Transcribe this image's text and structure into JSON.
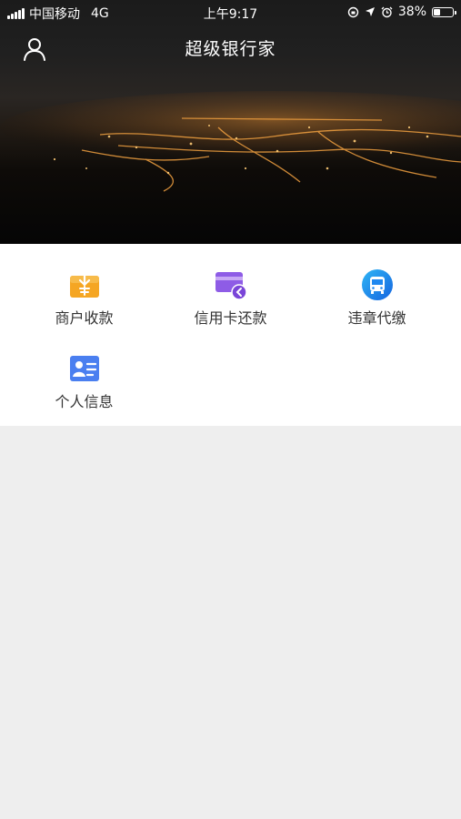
{
  "status_bar": {
    "carrier": "中国移动",
    "network": "4G",
    "time": "上午9:17",
    "battery_percent": "38%",
    "battery_level": 0.38
  },
  "header": {
    "title": "超级银行家",
    "user_icon": "user-icon"
  },
  "menu": {
    "items": [
      {
        "label": "商户收款",
        "icon": "merchant-payment-icon",
        "color": "#f5a623"
      },
      {
        "label": "信用卡还款",
        "icon": "credit-card-repay-icon",
        "color": "#8e5ce6"
      },
      {
        "label": "违章代缴",
        "icon": "traffic-fine-bus-icon",
        "color": "#1e88f0"
      },
      {
        "label": "个人信息",
        "icon": "personal-info-card-icon",
        "color": "#4a7ff0"
      }
    ]
  }
}
